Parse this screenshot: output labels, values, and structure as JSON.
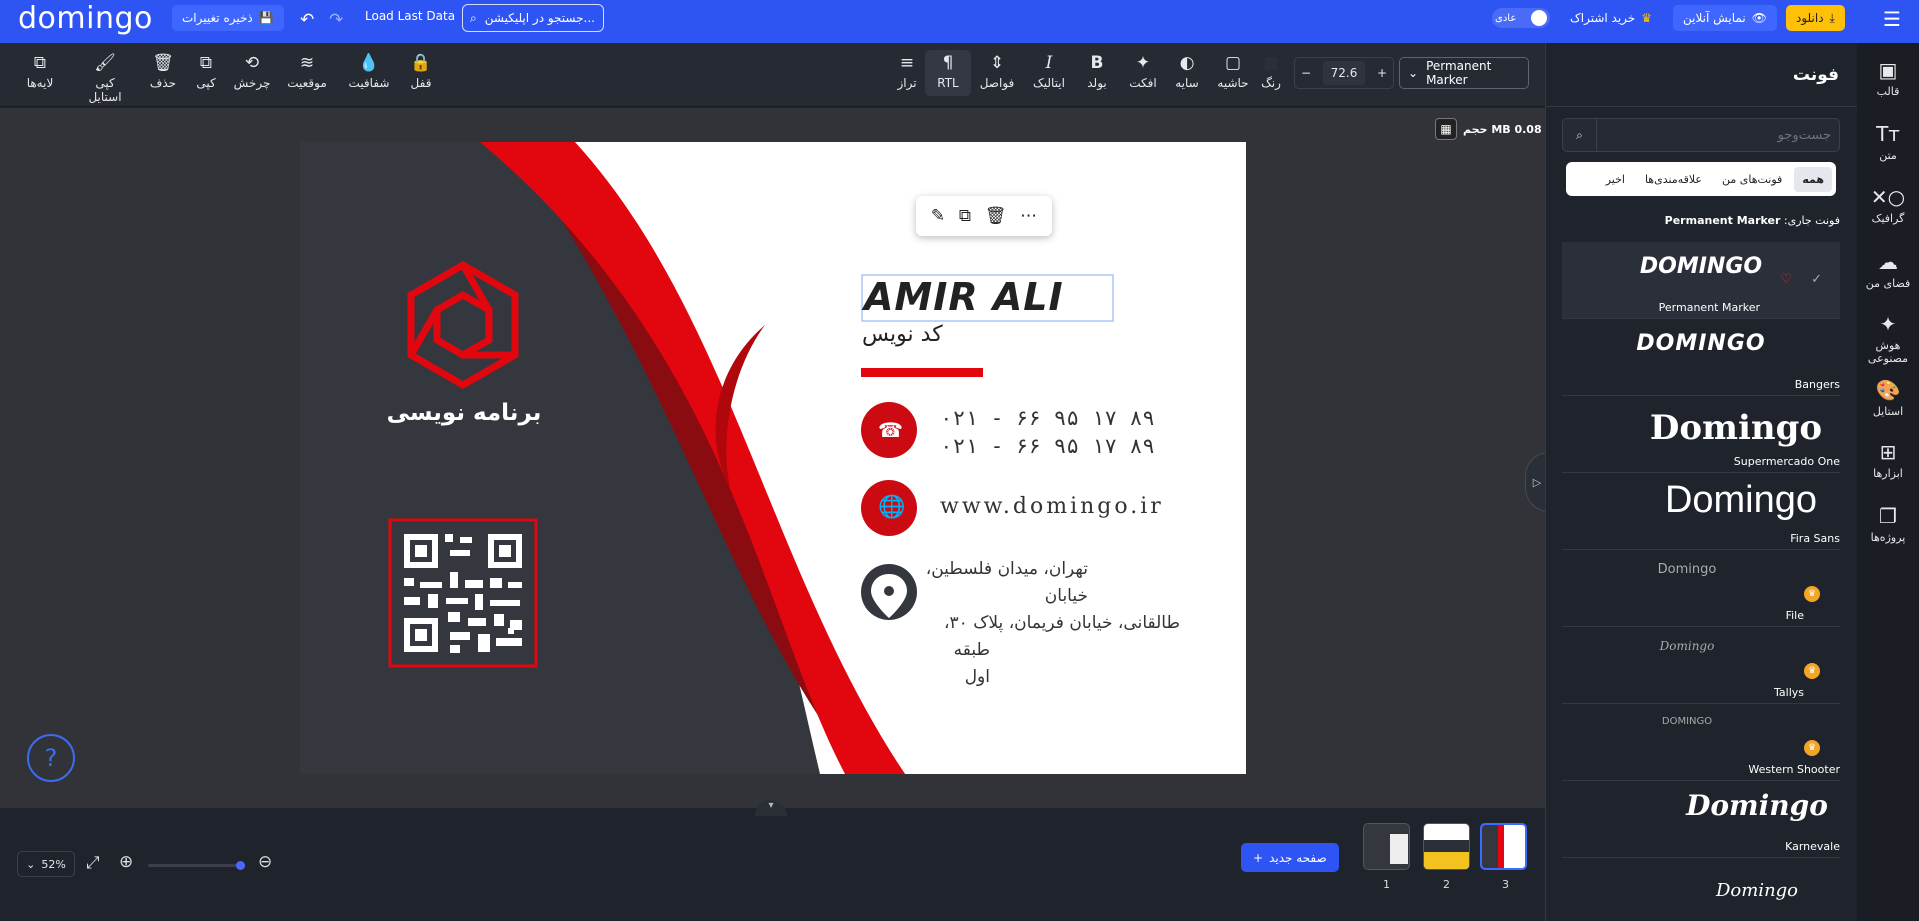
{
  "topbar": {
    "logo": "domingo",
    "save_label": "ذخیره تغییرات",
    "load_last": "Load Last Data",
    "search_placeholder": "جستجو در اپلیکیشن...",
    "mode_label": "عادی",
    "subscribe_label": "خرید اشتراک",
    "online_label": "نمایش آنلاین",
    "download_label": "دانلود"
  },
  "toolbar": {
    "layers": "لایه‌ها",
    "copy_style": "کپی استایل",
    "delete": "حذف",
    "copy": "کپی",
    "rotate": "چرخش",
    "position": "موقعیت",
    "opacity": "شفافیت",
    "lock": "قفل",
    "align": "تراز",
    "rtl": "RTL",
    "spacing": "فواصل",
    "italic": "ایتالیک",
    "bold": "بولد",
    "effect": "افکت",
    "shadow": "سایه",
    "border": "حاشیه",
    "color": "رنگ",
    "font_size": "72.6",
    "font_family": "Permanent Marker"
  },
  "canvas": {
    "file_size": "حجم MB 0.08"
  },
  "card": {
    "company": "برنامه نویسی",
    "name": "AMIR ALI",
    "title": "کد نویس",
    "phone1": "۰۲۱ - ۶۶ ۹۵ ۱۷ ۸۹",
    "phone2": "۰۲۱ - ۶۶ ۹۵ ۱۷ ۸۹",
    "website": "www.domingo.ir",
    "address1": "تهران، میدان فلسطین، خیابان",
    "address2": "طالقانی، خیابان فریمان، پلاک ۳۰،",
    "address3": "طبقه اول"
  },
  "bottom": {
    "zoom": "52%",
    "new_page": "صفحه جدید",
    "pages": [
      "1",
      "2",
      "3"
    ]
  },
  "panel": {
    "title": "فونت",
    "search_placeholder": "جست‌وجو",
    "tabs": [
      "همه",
      "فونت‌های من",
      "علاقه‌مندی‌ها",
      "اخیر"
    ],
    "current_prefix": "فونت جاری:",
    "current_font": "Permanent Marker",
    "fonts": [
      {
        "sample": "DOMINGO",
        "name": "Permanent Marker"
      },
      {
        "sample": "DOMINGO",
        "name": "Bangers"
      },
      {
        "sample": "Domingo",
        "name": "Supermercado One"
      },
      {
        "sample": "Domingo",
        "name": "Fira Sans"
      },
      {
        "sample": "Domingo",
        "name": "File"
      },
      {
        "sample": "Domingo",
        "name": "Tallys"
      },
      {
        "sample": "DOMINGO",
        "name": "Western Shooter"
      },
      {
        "sample": "Domingo",
        "name": "Karnevale"
      },
      {
        "sample": "Domingo",
        "name": ""
      }
    ]
  },
  "rail": {
    "template": "قالب",
    "text": "متن",
    "graphic": "گرافیک",
    "myspace": "فضای من",
    "ai1": "هوش",
    "ai2": "مصنوعی",
    "style": "استایل",
    "tools": "ابزارها",
    "projects": "پروژه‌ها"
  },
  "colors": {
    "brand": "#2e55f4",
    "red": "#e2060f",
    "dark_card": "#34383e"
  }
}
